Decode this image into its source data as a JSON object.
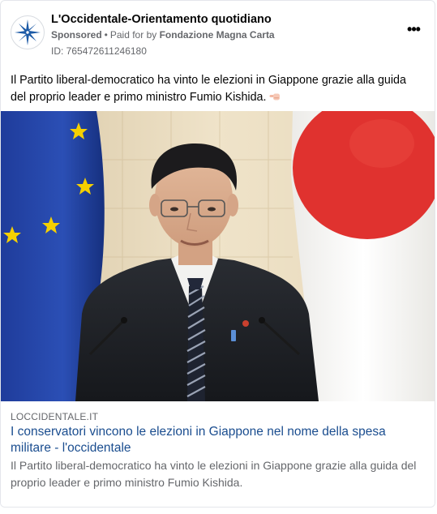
{
  "ad": {
    "page_name": "L'Occidentale-Orientamento quotidiano",
    "sponsored_label": "Sponsored",
    "separator": "•",
    "paid_for_prefix": "Paid for by",
    "paid_for_by": "Fondazione Magna Carta",
    "id_line": "ID: 765472611246180",
    "more_label": "•••",
    "body_text": "Il Partito liberal-democratico ha vinto le elezioni in Giappone grazie alla guida del proprio leader e primo ministro Fumio Kishida."
  },
  "link_preview": {
    "domain": "LOCCIDENTALE.IT",
    "headline": "I conservatori vincono le elezioni in Giappone nel nome della spesa militare - l'occidentale",
    "description": "Il Partito liberal-democratico ha vinto le elezioni in Giappone grazie alla guida del proprio leader e primo ministro Fumio Kishida."
  },
  "colors": {
    "eu_flag_blue": "#1f3c9b",
    "eu_star_yellow": "#f5d000",
    "japan_flag_red": "#e0322f",
    "headline_blue": "#1a4d8f"
  },
  "icons": {
    "avatar": "compass-rose-icon",
    "more": "ellipsis-icon",
    "emoji": "backhand-index-pointing-left-icon"
  }
}
